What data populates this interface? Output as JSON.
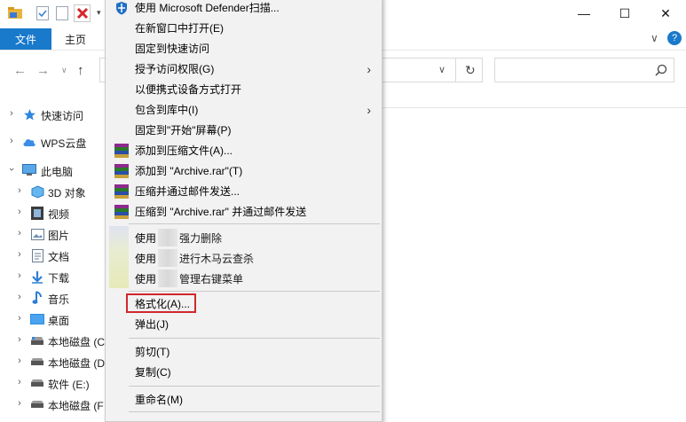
{
  "title_bar": {
    "quick_access_icons": [
      "folder-icon",
      "properties-check-icon",
      "new-folder-icon",
      "delete-x-icon"
    ],
    "window_buttons": {
      "minimize": "—",
      "maximize": "☐",
      "close": "✕"
    }
  },
  "ribbon": {
    "file_tab": "文件",
    "home_tab": "主页",
    "expand_chevron": "∨",
    "help": "?"
  },
  "nav_bar": {
    "back": "←",
    "forward": "→",
    "up": "↑",
    "refresh": "↻",
    "address_dropdown": "∨"
  },
  "nav_pane": {
    "items": [
      {
        "label": "快速访问",
        "icon": "star-icon"
      },
      {
        "label": "WPS云盘",
        "icon": "cloud-icon"
      },
      {
        "label": "此电脑",
        "icon": "computer-icon"
      },
      {
        "label": "3D 对象",
        "icon": "3d-objects-icon"
      },
      {
        "label": "视频",
        "icon": "video-icon"
      },
      {
        "label": "图片",
        "icon": "pictures-icon"
      },
      {
        "label": "文档",
        "icon": "documents-icon"
      },
      {
        "label": "下载",
        "icon": "download-icon"
      },
      {
        "label": "音乐",
        "icon": "music-icon"
      },
      {
        "label": "桌面",
        "icon": "desktop-icon"
      },
      {
        "label": "本地磁盘 (C",
        "icon": "drive-icon"
      },
      {
        "label": "本地磁盘 (D",
        "icon": "drive-icon"
      },
      {
        "label": "软件 (E:)",
        "icon": "drive-icon"
      },
      {
        "label": "本地磁盘 (F",
        "icon": "drive-icon"
      }
    ]
  },
  "context_menu": {
    "items": [
      {
        "label": "使用 Microsoft Defender扫描...",
        "icon": "defender-icon"
      },
      {
        "label": "在新窗口中打开(E)"
      },
      {
        "label": "固定到快速访问"
      },
      {
        "label": "授予访问权限(G)",
        "submenu": true
      },
      {
        "label": "以便携式设备方式打开"
      },
      {
        "label": "包含到库中(I)",
        "submenu": true
      },
      {
        "label": "固定到\"开始\"屏幕(P)"
      },
      {
        "label": "添加到压缩文件(A)...",
        "icon": "winrar-icon"
      },
      {
        "label": "添加到 \"Archive.rar\"(T)",
        "icon": "winrar-icon"
      },
      {
        "label": "压缩并通过邮件发送...",
        "icon": "winrar-icon"
      },
      {
        "label": "压缩到 \"Archive.rar\" 并通过邮件发送",
        "icon": "winrar-icon"
      },
      {
        "label_prefix": "使用",
        "label_suffix": "强力删除"
      },
      {
        "label_prefix": "使用",
        "label_suffix": "进行木马云查杀"
      },
      {
        "label_prefix": "使用",
        "label_suffix": "管理右键菜单"
      },
      {
        "label": "格式化(A)...",
        "highlighted": true
      },
      {
        "label": "弹出(J)"
      },
      {
        "label": "剪切(T)"
      },
      {
        "label": "复制(C)"
      },
      {
        "label": "重命名(M)"
      }
    ],
    "submenu_arrow": "›"
  },
  "colors": {
    "file_tab": "#1979ca",
    "highlight_border": "#d0282d",
    "menu_bg": "#f2f2f2"
  }
}
